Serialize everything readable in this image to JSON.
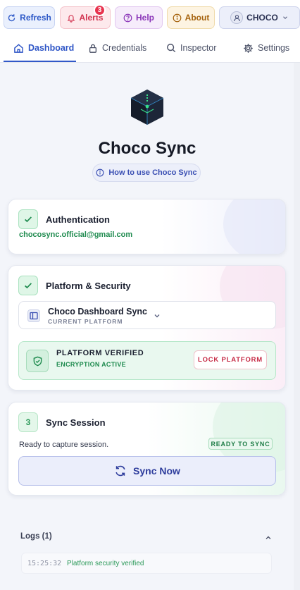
{
  "toolbar": {
    "refresh_label": "Refresh",
    "alerts_label": "Alerts",
    "alerts_count": "3",
    "help_label": "Help",
    "about_label": "About",
    "user_label": "CHOCO"
  },
  "tabs": [
    {
      "label": "Dashboard",
      "icon": "home-icon",
      "active": true
    },
    {
      "label": "Credentials",
      "icon": "lock-icon",
      "active": false
    },
    {
      "label": "Inspector",
      "icon": "search-icon",
      "active": false
    },
    {
      "label": "Settings",
      "icon": "gear-icon",
      "active": false
    }
  ],
  "hero": {
    "app_name": "Choco Sync",
    "howto_label": "How to use Choco Sync"
  },
  "auth": {
    "title": "Authentication",
    "email": "chocosync.official@gmail.com"
  },
  "platform": {
    "title": "Platform & Security",
    "selected_name": "Choco Dashboard Sync",
    "selected_sub": "CURRENT PLATFORM",
    "verified_title": "PLATFORM VERIFIED",
    "verified_sub": "ENCRYPTION ACTIVE",
    "lock_label": "LOCK PLATFORM"
  },
  "session": {
    "step": "3",
    "title": "Sync Session",
    "status": "Ready to capture session.",
    "badge": "READY TO SYNC",
    "sync_label": "Sync Now"
  },
  "logs": {
    "title": "Logs (1)",
    "entries": [
      {
        "time": "15:25:32",
        "message": "Platform security verified"
      }
    ]
  },
  "colors": {
    "accent": "#3158c8",
    "success": "#1f8b4f",
    "danger": "#d2334f"
  }
}
